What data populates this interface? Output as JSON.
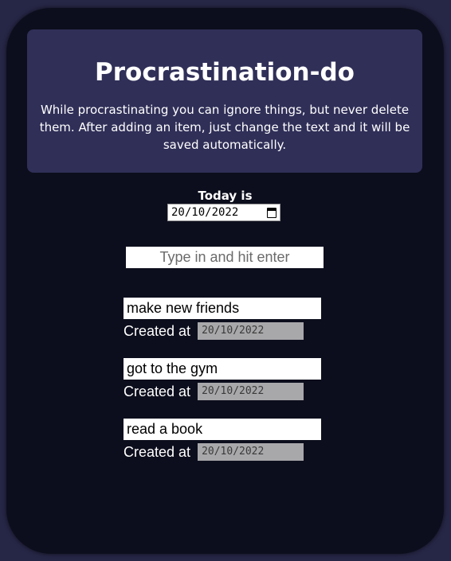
{
  "header": {
    "title": "Procrastination-do",
    "subtitle": "While procrastinating you can ignore things, but never delete them. After adding an item, just change the text and it will be saved automatically."
  },
  "today": {
    "label": "Today is",
    "date": "20/10/2022"
  },
  "new_item": {
    "placeholder": "Type in and hit enter",
    "value": ""
  },
  "items": [
    {
      "text": "make new friends",
      "created_label": "Created at",
      "created_date": "20/10/2022"
    },
    {
      "text": "got to the gym",
      "created_label": "Created at",
      "created_date": "20/10/2022"
    },
    {
      "text": "read a book",
      "created_label": "Created at",
      "created_date": "20/10/2022"
    }
  ],
  "colors": {
    "page_background": "#262646",
    "app_background": "#0d0e1d",
    "header_background": "#302f58",
    "created_date_background": "#a8a8ab"
  },
  "icons": {
    "date_picker": "calendar-icon"
  }
}
